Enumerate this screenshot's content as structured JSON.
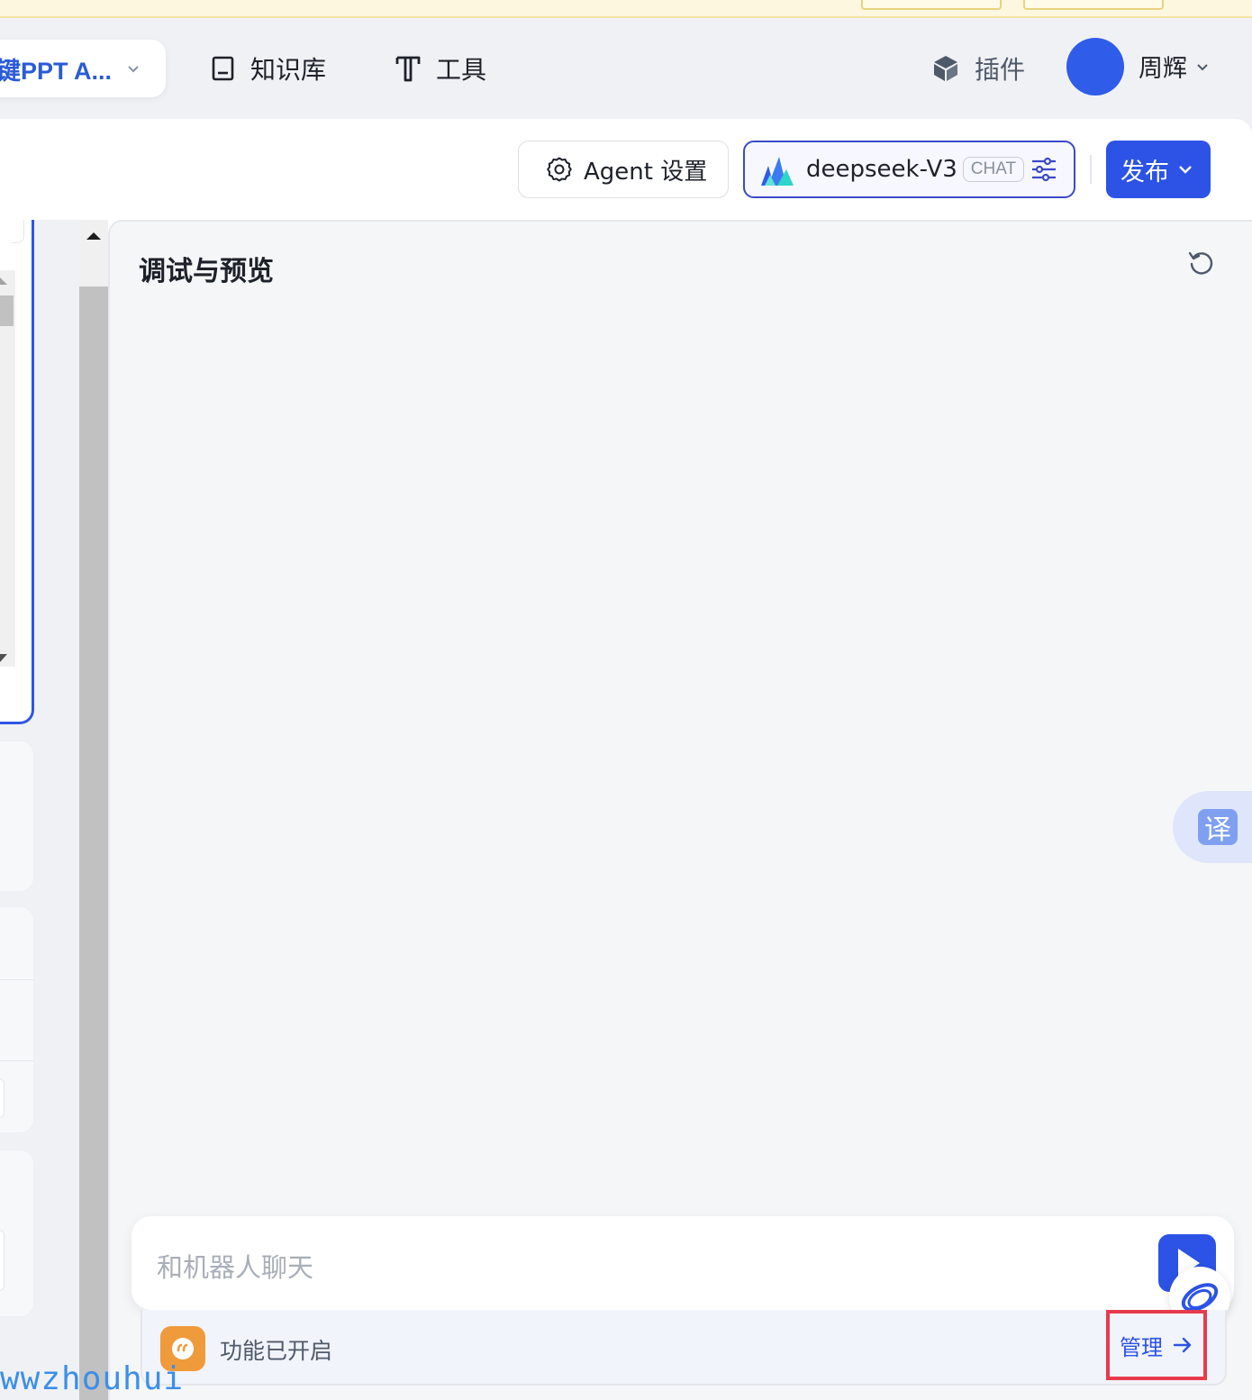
{
  "topnav": {
    "app_name": "键PPT A...",
    "knowledge_label": "知识库",
    "tools_label": "工具",
    "plugins_label": "插件",
    "user_name": "周辉"
  },
  "toolbar": {
    "agent_settings_label": "Agent 设置",
    "model_name": "deepseek-V3",
    "model_tag": "CHAT",
    "publish_label": "发布"
  },
  "preview": {
    "title": "调试与预览",
    "chat_placeholder": "和机器人聊天",
    "translate_label": "译",
    "feature_status": "功能已开启",
    "manage_label": "管理"
  },
  "watermark": "wwzhouhui",
  "colors": {
    "accent": "#2c53e5",
    "highlight_border": "#e83a4d",
    "feature_icon": "#ef9a3b"
  },
  "icons": [
    "book-icon",
    "tool-t-icon",
    "plugin-cube-icon",
    "gear-icon",
    "model-logo-icon",
    "tune-sliders-icon",
    "chevron-down-icon",
    "refresh-icon",
    "send-icon",
    "quote-icon",
    "arrow-right-icon"
  ]
}
